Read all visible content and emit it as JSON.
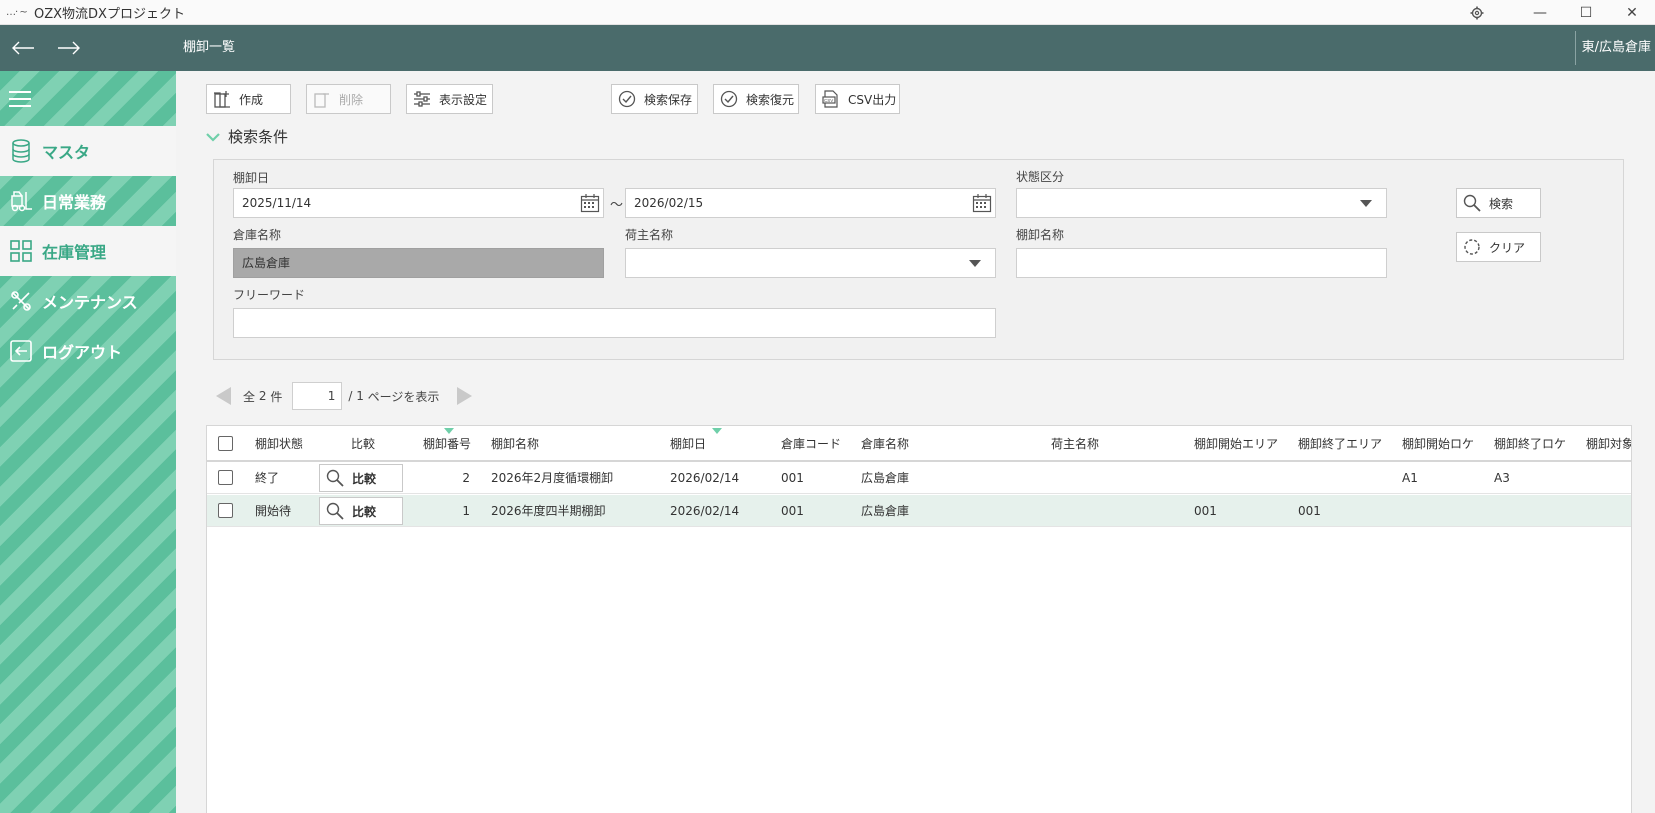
{
  "window": {
    "app_icon": "…· ~",
    "title": "OZX物流DXプロジェクト",
    "minimize": "—",
    "maximize": "☐",
    "close": "✕"
  },
  "header": {
    "page_title": "棚卸一覧",
    "warehouse": "東/広島倉庫"
  },
  "sidebar": {
    "items": [
      {
        "label": "マスタ",
        "icon": "database-icon"
      },
      {
        "label": "日常業務",
        "icon": "forklift-icon"
      },
      {
        "label": "在庫管理",
        "icon": "grid-icon"
      },
      {
        "label": "メンテナンス",
        "icon": "tools-icon"
      },
      {
        "label": "ログアウト",
        "icon": "logout-icon"
      }
    ]
  },
  "toolbar": {
    "create": "作成",
    "delete": "削除",
    "display_settings": "表示設定",
    "save_search": "検索保存",
    "restore_search": "検索復元",
    "csv_export": "CSV出力"
  },
  "search": {
    "section_title": "検索条件",
    "date_label": "棚卸日",
    "date_from": "2025/11/14",
    "date_to": "2026/02/15",
    "tilde": "～",
    "status_label": "状態区分",
    "status_value": "",
    "warehouse_label": "倉庫名称",
    "warehouse_value": "広島倉庫",
    "shipper_label": "荷主名称",
    "shipper_value": "",
    "inventory_name_label": "棚卸名称",
    "inventory_name_value": "",
    "freeword_label": "フリーワード",
    "freeword_value": "",
    "search_button": "検索",
    "clear_button": "クリア"
  },
  "paging": {
    "total_prefix": "全",
    "total_count": "2",
    "total_suffix": "件",
    "current_page": "1",
    "separator": "/",
    "total_pages": "1",
    "page_suffix": "ページを表示"
  },
  "grid": {
    "columns": [
      "棚卸状態",
      "比較",
      "棚卸番号",
      "棚卸名称",
      "棚卸日",
      "倉庫コード",
      "倉庫名称",
      "荷主名称",
      "棚卸開始エリア",
      "棚卸終了エリア",
      "棚卸開始ロケ",
      "棚卸終了ロケ",
      "棚卸対象"
    ],
    "rows": [
      {
        "status": "終了",
        "compare": "比較",
        "number": "2",
        "name": "2026年2月度循環棚卸",
        "date": "2026/02/14",
        "wh_code": "001",
        "wh_name": "広島倉庫",
        "shipper": "",
        "start_area": "",
        "end_area": "",
        "start_loc": "A1",
        "end_loc": "A3"
      },
      {
        "status": "開始待",
        "compare": "比較",
        "number": "1",
        "name": "2026年度四半期棚卸",
        "date": "2026/02/14",
        "wh_code": "001",
        "wh_name": "広島倉庫",
        "shipper": "",
        "start_area": "001",
        "end_area": "001",
        "start_loc": "",
        "end_loc": ""
      }
    ]
  }
}
